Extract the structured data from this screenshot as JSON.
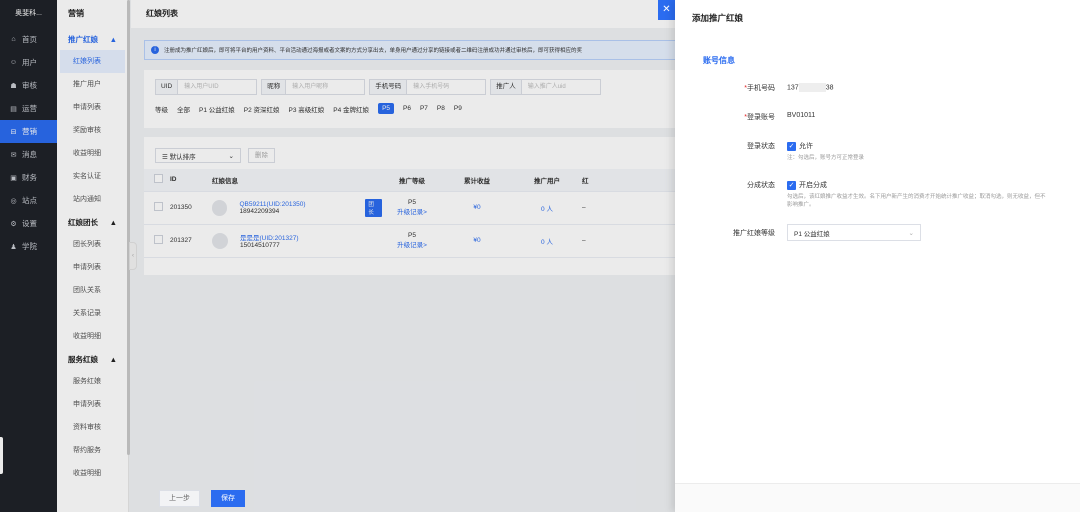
{
  "brand": "奥斐科...",
  "nav": [
    {
      "label": "首页",
      "icon": "home-icon",
      "glyph": "⌂"
    },
    {
      "label": "用户",
      "icon": "user-icon",
      "glyph": "☺"
    },
    {
      "label": "审核",
      "icon": "audit-icon",
      "glyph": "☗"
    },
    {
      "label": "运营",
      "icon": "operate-icon",
      "glyph": "▤"
    },
    {
      "label": "营销",
      "icon": "marketing-icon",
      "glyph": "⊟"
    },
    {
      "label": "消息",
      "icon": "message-icon",
      "glyph": "✉"
    },
    {
      "label": "财务",
      "icon": "finance-icon",
      "glyph": "▣"
    },
    {
      "label": "站点",
      "icon": "site-icon",
      "glyph": "◎"
    },
    {
      "label": "设置",
      "icon": "settings-icon",
      "glyph": "⚙"
    },
    {
      "label": "学院",
      "icon": "academy-icon",
      "glyph": "♟"
    }
  ],
  "sub": {
    "title": "营销",
    "group1": "推广红娘",
    "group1_items": [
      "红娘列表",
      "推广用户",
      "申请列表",
      "奖励审核",
      "收益明细",
      "实名认证",
      "站内通知"
    ],
    "group2": "红娘团长",
    "group2_items": [
      "团长列表",
      "申请列表",
      "团队关系",
      "关系记录",
      "收益明细"
    ],
    "group3": "服务红娘",
    "group3_items": [
      "服务红娘",
      "申请列表",
      "资料审核",
      "帮约服务",
      "收益明细"
    ]
  },
  "main": {
    "title": "红娘列表",
    "notice": "注册成为推广红娘后，即可将平台的用户资料、平台活动通过海报或者文案的方式分享出去，单身用户通过分享的链接或者二维码注册成功并通过审核后，即可获得相应的奖",
    "filters": [
      {
        "label": "UID",
        "placeholder": "输入用户UID"
      },
      {
        "label": "昵称",
        "placeholder": "输入用户昵称"
      },
      {
        "label": "手机号码",
        "placeholder": "输入手机号码"
      },
      {
        "label": "推广人",
        "placeholder": "输入推广人uid"
      }
    ],
    "level_label": "等级",
    "levels": [
      "全部",
      "P1 公益红娘",
      "P2 资深红娘",
      "P3 高级红娘",
      "P4 金牌红娘",
      "P5",
      "P6",
      "P7",
      "P8",
      "P9"
    ],
    "sort": "默认排序",
    "delete": "删除",
    "columns": [
      "ID",
      "红娘信息",
      "推广等级",
      "累计收益",
      "推广用户",
      "红"
    ],
    "rows": [
      {
        "id": "201350",
        "name": "QB59211(UID:201350)",
        "phone": "18942209394",
        "tag": "团长",
        "level": "P5",
        "upgrade": "升级记录>",
        "income": "¥0",
        "users": "0 人",
        "dash": "–"
      },
      {
        "id": "201327",
        "name": "是是是(UID:201327)",
        "phone": "15014510777",
        "tag": "",
        "level": "P5",
        "upgrade": "升级记录>",
        "income": "¥0",
        "users": "0 人",
        "dash": "–"
      }
    ]
  },
  "drawer": {
    "title": "添加推广红娘",
    "section": "账号信息",
    "phone_label": "手机号码",
    "phone_prefix": "137",
    "phone_suffix": "38",
    "account_label": "登录账号",
    "account_value": "BV01011",
    "login_label": "登录状态",
    "login_check": "允许",
    "login_tip": "注：勾选后，账号方可正常登录",
    "share_label": "分成状态",
    "share_check": "开启分成",
    "share_tip": "勾选后，该红娘推广收益才生效。名下用户新产生的消费才开始统计推广收益；取消勾选，则无收益，但不影响推广。",
    "level_label": "推广红娘等级",
    "level_value": "P1 公益红娘",
    "prev": "上一步",
    "save": "保存"
  },
  "colors": {
    "accent": "#2b6cf0",
    "sidebar": "#1f2229"
  }
}
